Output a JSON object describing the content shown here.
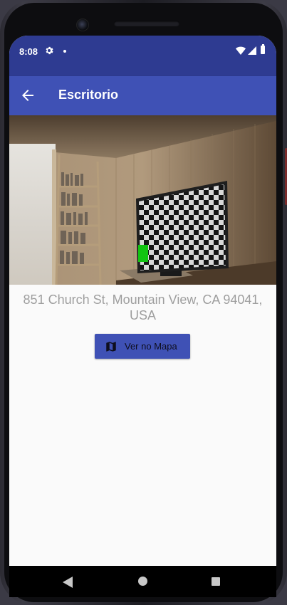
{
  "status_bar": {
    "time": "8:08",
    "icons": [
      "gear-icon",
      "notification-dot",
      "wifi-icon",
      "signal-icon",
      "battery-icon"
    ]
  },
  "app_bar": {
    "title": "Escritorio",
    "back_icon": "arrow-back-icon",
    "color": "#3f51b5"
  },
  "place": {
    "image": "room-with-bookshelf-and-tv-photo",
    "address": "851 Church St, Mountain View, CA 94041, USA",
    "map_button_label": "Ver no Mapa",
    "map_button_icon": "map-icon"
  },
  "nav_bar": {
    "buttons": [
      "back-triangle-icon",
      "home-circle-icon",
      "recents-square-icon"
    ]
  },
  "colors": {
    "status_bar": "#2e3b91",
    "primary": "#3f51b5",
    "address_text": "#9e9e9e",
    "background": "#fafafa"
  }
}
